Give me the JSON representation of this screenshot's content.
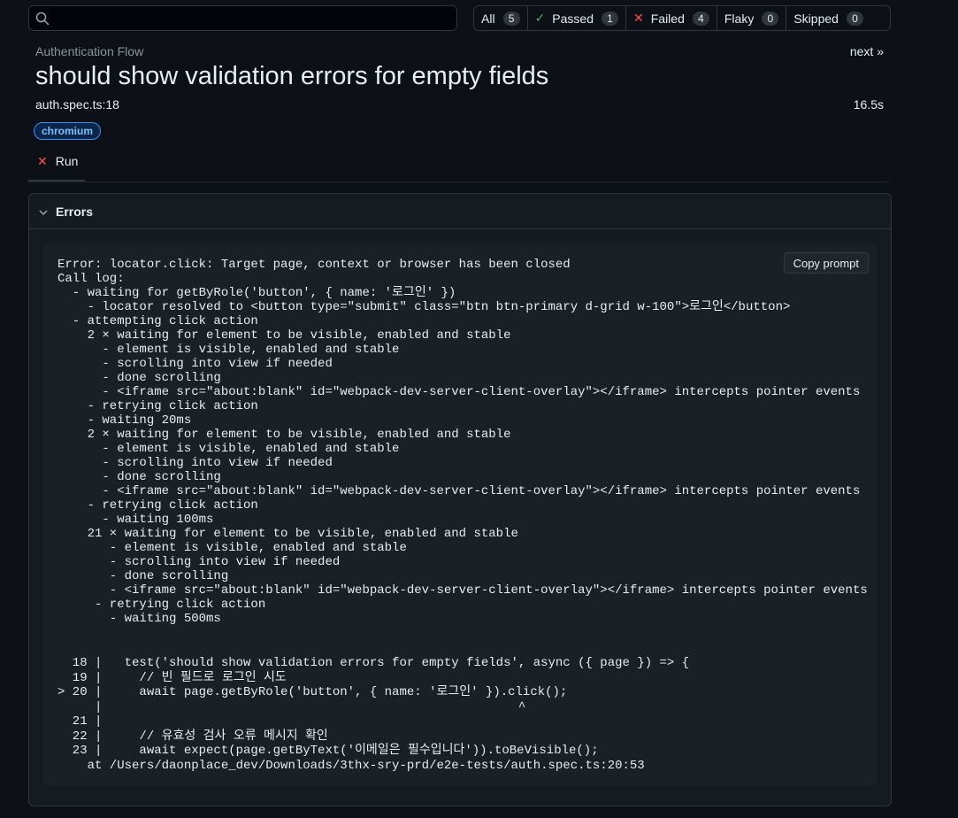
{
  "search": {
    "value": "",
    "placeholder": ""
  },
  "filters": [
    {
      "label": "All",
      "count": "5",
      "icon": ""
    },
    {
      "label": "Passed",
      "count": "1",
      "icon": "check-icon",
      "icon_glyph": "✓",
      "icon_color": "#3fb950"
    },
    {
      "label": "Failed",
      "count": "4",
      "icon": "x-icon",
      "icon_glyph": "✕",
      "icon_color": "#f85149"
    },
    {
      "label": "Flaky",
      "count": "0",
      "icon": ""
    },
    {
      "label": "Skipped",
      "count": "0",
      "icon": ""
    }
  ],
  "header": {
    "breadcrumb": "Authentication Flow",
    "next_label": "next »",
    "title": "should show validation errors for empty fields",
    "location": "auth.spec.ts:18",
    "duration": "16.5s",
    "badge": "chromium"
  },
  "tabs": [
    {
      "label": "Run",
      "icon": "x-icon",
      "icon_glyph": "✕"
    }
  ],
  "errors": {
    "title": "Errors",
    "copy_label": "Copy prompt",
    "message": "Error: locator.click: Target page, context or browser has been closed\nCall log:\n  - waiting for getByRole('button', { name: '로그인' })\n    - locator resolved to <button type=\"submit\" class=\"btn btn-primary d-grid w-100\">로그인</button>\n  - attempting click action\n    2 × waiting for element to be visible, enabled and stable\n      - element is visible, enabled and stable\n      - scrolling into view if needed\n      - done scrolling\n      - <iframe src=\"about:blank\" id=\"webpack-dev-server-client-overlay\"></iframe> intercepts pointer events\n    - retrying click action\n    - waiting 20ms\n    2 × waiting for element to be visible, enabled and stable\n      - element is visible, enabled and stable\n      - scrolling into view if needed\n      - done scrolling\n      - <iframe src=\"about:blank\" id=\"webpack-dev-server-client-overlay\"></iframe> intercepts pointer events\n    - retrying click action\n      - waiting 100ms\n    21 × waiting for element to be visible, enabled and stable\n       - element is visible, enabled and stable\n       - scrolling into view if needed\n       - done scrolling\n       - <iframe src=\"about:blank\" id=\"webpack-dev-server-client-overlay\"></iframe> intercepts pointer events\n     - retrying click action\n       - waiting 500ms",
    "code": "  18 |   test('should show validation errors for empty fields', async ({ page }) => {\n  19 |     // 빈 필드로 로그인 시도\n> 20 |     await page.getByRole('button', { name: '로그인' }).click();\n     |                                                        ^\n  21 |\n  22 |     // 유효성 검사 오류 메시지 확인\n  23 |     await expect(page.getByText('이메일은 필수입니다')).toBeVisible();\n    at /Users/daonplace_dev/Downloads/3thx-sry-prd/e2e-tests/auth.spec.ts:20:53"
  }
}
